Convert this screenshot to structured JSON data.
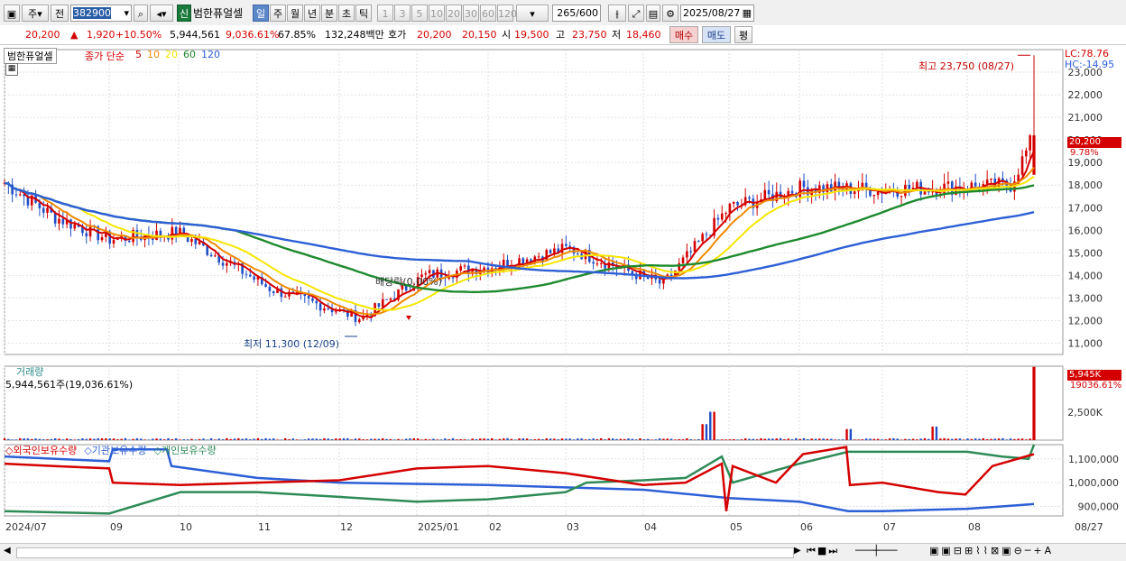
{
  "toolbar": {
    "view_label": "주",
    "prev_label": "전",
    "code": "382900",
    "stock_badge": "신",
    "stock_name": "범한퓨얼셀",
    "periods": [
      "일",
      "주",
      "월",
      "년",
      "분",
      "초",
      "틱"
    ],
    "selected_period": "일",
    "intervals": [
      "1",
      "3",
      "5",
      "10",
      "20",
      "30",
      "60",
      "120"
    ],
    "count": "265",
    "count_total": "/600",
    "date": "2025/08/27"
  },
  "quote": {
    "price": "20,200",
    "change": "1,920",
    "change_pct": "+10.50%",
    "volume": "5,944,561",
    "volume_ratio": "9,036.61%",
    "turnover": "67.85%",
    "amount": "132,248백만",
    "bid_label": "호가",
    "ask": "20,200",
    "bid": "20,150",
    "open_label": "시",
    "open": "19,500",
    "high_label": "고",
    "high": "23,750",
    "low_label": "저",
    "low": "18,460",
    "buy_label": "매수",
    "sell_label": "매도",
    "eval_label": "평"
  },
  "price_panel": {
    "name_tag": "범한퓨얼셀",
    "ma_title": "종가 단순",
    "ma_periods": [
      "5",
      "10",
      "20",
      "60",
      "120"
    ],
    "ma_colors": [
      "#d40000",
      "#f08a00",
      "#f5e600",
      "#1e8a2e",
      "#2d5fd6"
    ],
    "lc_label": "LC:78.76",
    "hc_label": "HC:-14.95",
    "high_note": "최고 23,750 (08/27)",
    "low_note": "최저 11,300 (12/09)",
    "event_note": "배당락(0.00%)",
    "last_price_tag": "20,200",
    "last_change_tag": "9.78%"
  },
  "volume_panel": {
    "title": "거래량",
    "value_text": "5,944,561주(19,036.61%)",
    "last_tag": "5,945K",
    "last_tag2": "19036.61%"
  },
  "holdings_panel": {
    "series_names": [
      "외국인보유수량",
      "기관보유수량",
      "개인보유수량"
    ],
    "colors": [
      "#d40000",
      "#2d5fd6",
      "#2e8b57"
    ]
  },
  "chart_data": {
    "type": "candlestick",
    "title": "범한퓨얼셀",
    "x_labels": [
      "2024/07",
      "09",
      "10",
      "11",
      "12",
      "2025/01",
      "02",
      "03",
      "04",
      "05",
      "06",
      "07",
      "08",
      "08/27"
    ],
    "price_axis": {
      "range": [
        10500,
        24000
      ],
      "ticks": [
        11000,
        12000,
        13000,
        14000,
        15000,
        16000,
        17000,
        18000,
        19000,
        20000,
        21000,
        22000,
        23000
      ]
    },
    "volume_axis": {
      "ticks_label": [
        "2,500K"
      ]
    },
    "holdings_axis": {
      "ticks": [
        900000,
        1000000,
        1100000
      ],
      "tick_labels": [
        "900,000",
        "1,000,000",
        "1,100,000"
      ]
    },
    "highlights": {
      "high": 23750,
      "high_date": "08/27",
      "low": 11300,
      "low_date": "12/09",
      "last_close": 20200
    },
    "close_approx": [
      {
        "label": "2024/07",
        "value": 18100
      },
      {
        "label": "08",
        "value": 16600
      },
      {
        "label": "09",
        "value": 15600
      },
      {
        "label": "10",
        "value": 15900
      },
      {
        "label": "11",
        "value": 13400
      },
      {
        "label": "12",
        "value": 12100
      },
      {
        "label": "2025/01",
        "value": 14000
      },
      {
        "label": "02",
        "value": 14400
      },
      {
        "label": "03",
        "value": 15200
      },
      {
        "label": "04",
        "value": 13600
      },
      {
        "label": "05",
        "value": 17000
      },
      {
        "label": "06",
        "value": 17900
      },
      {
        "label": "07",
        "value": 17800
      },
      {
        "label": "08",
        "value": 18000
      },
      {
        "label": "08/27",
        "value": 20200
      }
    ]
  }
}
